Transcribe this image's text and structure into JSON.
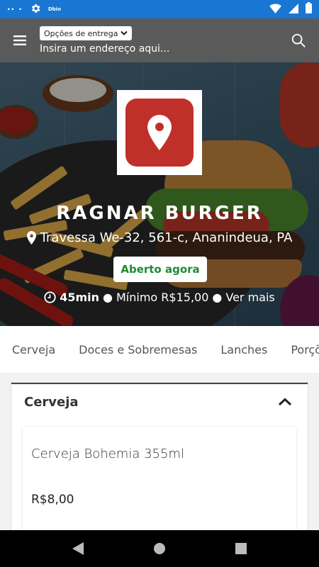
{
  "status_bar": {
    "signal_dots": "·· ·",
    "mini_label": "Dbio",
    "icons": [
      "settings-icon",
      "wifi-icon",
      "cell-signal-icon",
      "battery-icon"
    ]
  },
  "app_bar": {
    "delivery_options_label": "Opções de entrega",
    "address_placeholder": "Insira um endereço aqui..."
  },
  "restaurant": {
    "name": "RAGNAR BURGER",
    "address": "Travessa We-32, 561-c, Ananindeua, PA",
    "status": "Aberto agora",
    "delivery_time": "45min",
    "minimum": "Mínimo R$15,00",
    "see_more": "Ver mais"
  },
  "tabs": [
    "Cerveja",
    "Doces e Sobremesas",
    "Lanches",
    "Porções"
  ],
  "section": {
    "title": "Cerveja",
    "products": [
      {
        "name": "Cerveja Bohemia 355ml",
        "price": "R$8,00"
      }
    ]
  },
  "colors": {
    "status_bar": "#1976d2",
    "app_bar": "#5a5a5a",
    "open_badge_text": "#1d8a35",
    "logo_red": "#c0302a"
  }
}
